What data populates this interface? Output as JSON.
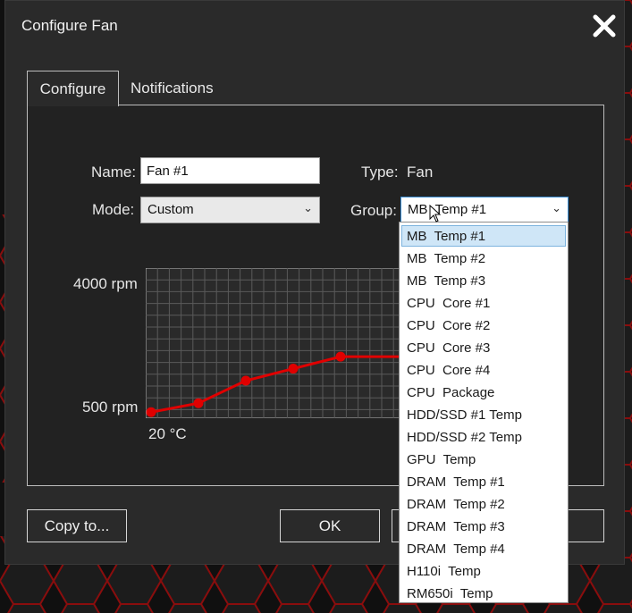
{
  "window": {
    "title": "Configure Fan"
  },
  "tabs": [
    {
      "label": "Configure",
      "active": true
    },
    {
      "label": "Notifications",
      "active": false
    }
  ],
  "form": {
    "name_label": "Name:",
    "name_value": "Fan #1",
    "mode_label": "Mode:",
    "mode_value": "Custom",
    "type_label": "Type:",
    "type_value": "Fan",
    "group_label": "Group:",
    "group_value": "MB  Temp #1"
  },
  "graph": {
    "y_max_label": "4000 rpm",
    "y_min_label": "500 rpm",
    "x_min_label": "20 °C",
    "curve_color": "#e00000",
    "points": [
      {
        "temp_index": 0,
        "rpm_fraction": 0.04
      },
      {
        "temp_index": 1,
        "rpm_fraction": 0.1
      },
      {
        "temp_index": 2,
        "rpm_fraction": 0.25
      },
      {
        "temp_index": 3,
        "rpm_fraction": 0.33
      },
      {
        "temp_index": 4,
        "rpm_fraction": 0.41
      }
    ]
  },
  "dropdown": {
    "selected_index": 0,
    "options": [
      "MB  Temp #1",
      "MB  Temp #2",
      "MB  Temp #3",
      "CPU  Core #1",
      "CPU  Core #2",
      "CPU  Core #3",
      "CPU  Core #4",
      "CPU  Package",
      "HDD/SSD #1 Temp",
      "HDD/SSD #2 Temp",
      "GPU  Temp",
      "DRAM  Temp #1",
      "DRAM  Temp #2",
      "DRAM  Temp #3",
      "DRAM  Temp #4",
      "H110i  Temp",
      "RM650i  Temp"
    ]
  },
  "buttons": {
    "copy_to": "Copy to...",
    "ok": "OK"
  }
}
